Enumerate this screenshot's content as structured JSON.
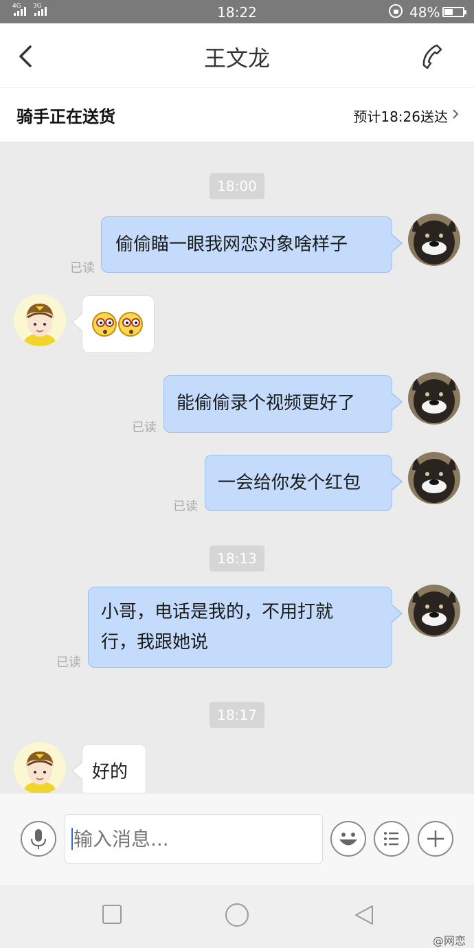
{
  "status_bar": {
    "network_1": "4G",
    "network_2": "3G",
    "time": "18:22",
    "battery_text": "48%",
    "battery_level": 0.48
  },
  "header": {
    "title": "王文龙"
  },
  "delivery": {
    "status": "骑手正在送货",
    "eta": "预计18:26送达"
  },
  "chat": {
    "timestamps": [
      "18:00",
      "18:13",
      "18:17"
    ],
    "messages": [
      {
        "from": "me",
        "text": "偷偷瞄一眼我网恋对象啥样子",
        "read": "已读"
      },
      {
        "from": "rider",
        "content": "emoji-shocked-x2"
      },
      {
        "from": "me",
        "text": "能偷偷录个视频更好了",
        "read": "已读"
      },
      {
        "from": "me",
        "text": "一会给你发个红包",
        "read": "已读"
      },
      {
        "from": "me",
        "text_line1": "小哥，电话是我的，不用打就",
        "text_line2": "行，我跟她说",
        "read": "已读"
      },
      {
        "from": "rider",
        "text": "好的"
      }
    ]
  },
  "input": {
    "placeholder": "输入消息..."
  },
  "watermark": "@网恋",
  "colors": {
    "my_bubble": "#c5dbfb",
    "my_bubble_border": "#9dbff0",
    "timestamp_bg": "#d6d6d6",
    "chat_bg": "#ebebeb"
  },
  "icons": [
    "back-arrow-icon",
    "phone-icon",
    "chevron-right-icon",
    "microphone-icon",
    "emoji-icon",
    "list-icon",
    "plus-icon",
    "nav-square-icon",
    "nav-circle-icon",
    "nav-triangle-icon"
  ]
}
